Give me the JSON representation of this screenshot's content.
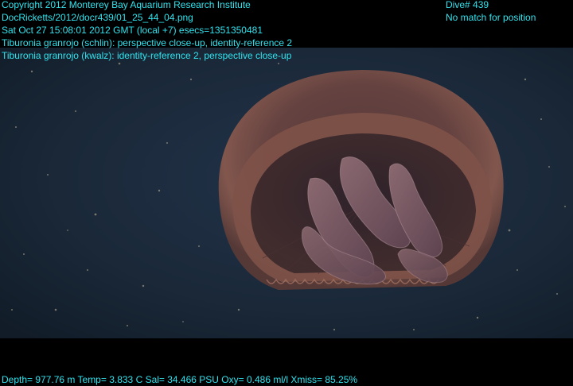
{
  "overlay": {
    "copyright": "Copyright 2012 Monterey Bay Aquarium Research Institute",
    "filename": "DocRicketts/2012/docr439/01_25_44_04.png",
    "datetime": "Sat Oct 27 15:08:01 2012 GMT (local +7)  esecs=1351350481",
    "annotation_1": "Tiburonia granrojo (schlin): perspective close-up, identity-reference 2",
    "annotation_2": "Tiburonia granrojo (kwalz): identity-reference 2, perspective close-up",
    "dive": "Dive# 439",
    "position": "No match for position",
    "telemetry": "Depth= 977.76 m  Temp= 3.833 C  Sal= 34.466 PSU  Oxy= 0.486 ml/l  Xmiss= 85.25%"
  },
  "colors": {
    "overlay_text": "#2fe3ee",
    "water": "#1a2838",
    "bell": "#7a4b44"
  }
}
